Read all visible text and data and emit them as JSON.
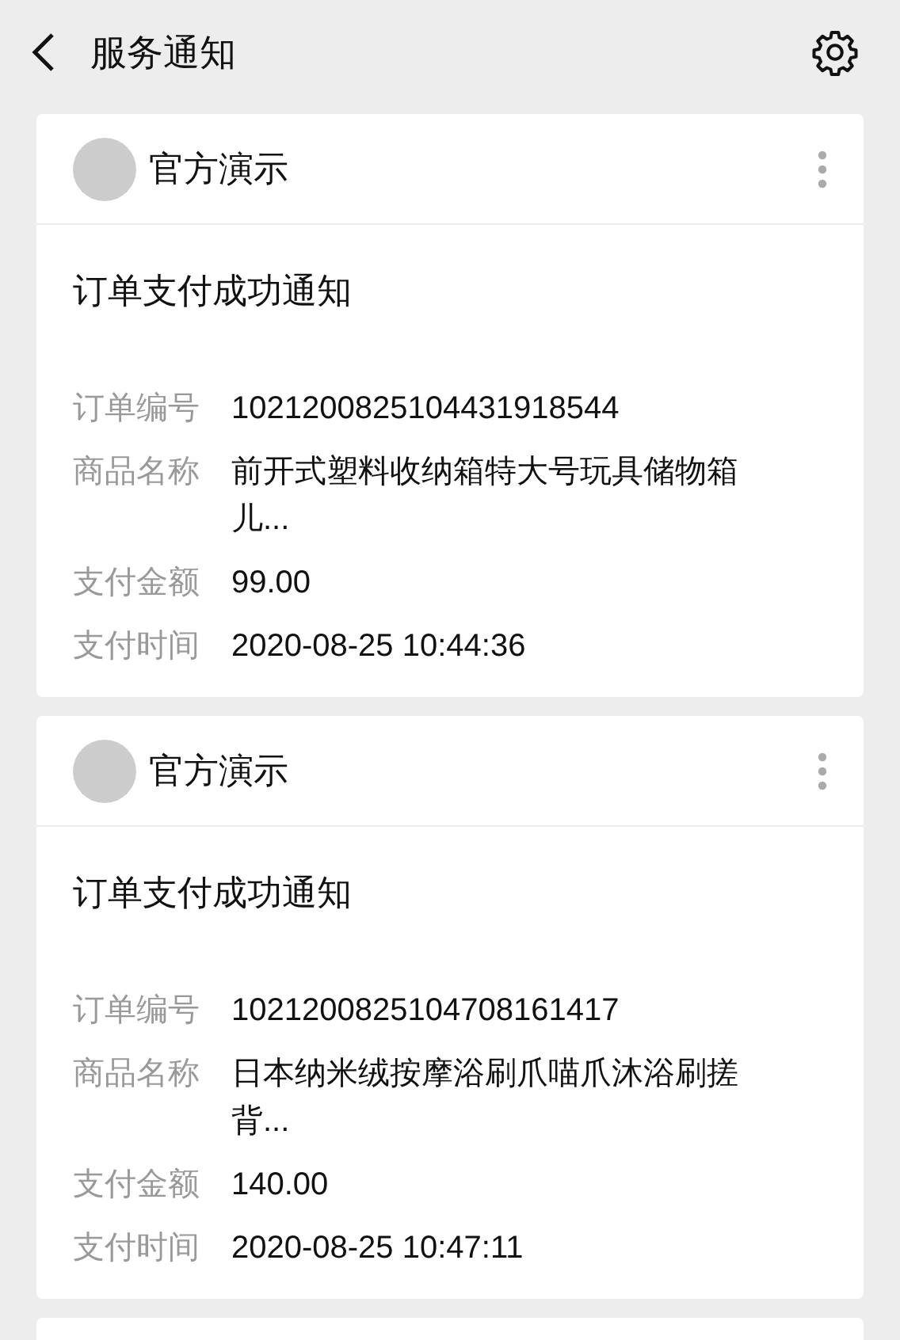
{
  "header": {
    "title": "服务通知"
  },
  "messages": [
    {
      "sender": "官方演示",
      "title": "订单支付成功通知",
      "fields": [
        {
          "label": "订单编号",
          "value": "1021200825104431918544"
        },
        {
          "label": "商品名称",
          "value": "前开式塑料收纳箱特大号玩具储物箱儿..."
        },
        {
          "label": "支付金额",
          "value": "99.00"
        },
        {
          "label": "支付时间",
          "value": "2020-08-25 10:44:36"
        }
      ]
    },
    {
      "sender": "官方演示",
      "title": "订单支付成功通知",
      "fields": [
        {
          "label": "订单编号",
          "value": "1021200825104708161417"
        },
        {
          "label": "商品名称",
          "value": "日本纳米绒按摩浴刷爪喵爪沐浴刷搓背..."
        },
        {
          "label": "支付金额",
          "value": "140.00"
        },
        {
          "label": "支付时间",
          "value": "2020-08-25 10:47:11"
        }
      ]
    }
  ]
}
